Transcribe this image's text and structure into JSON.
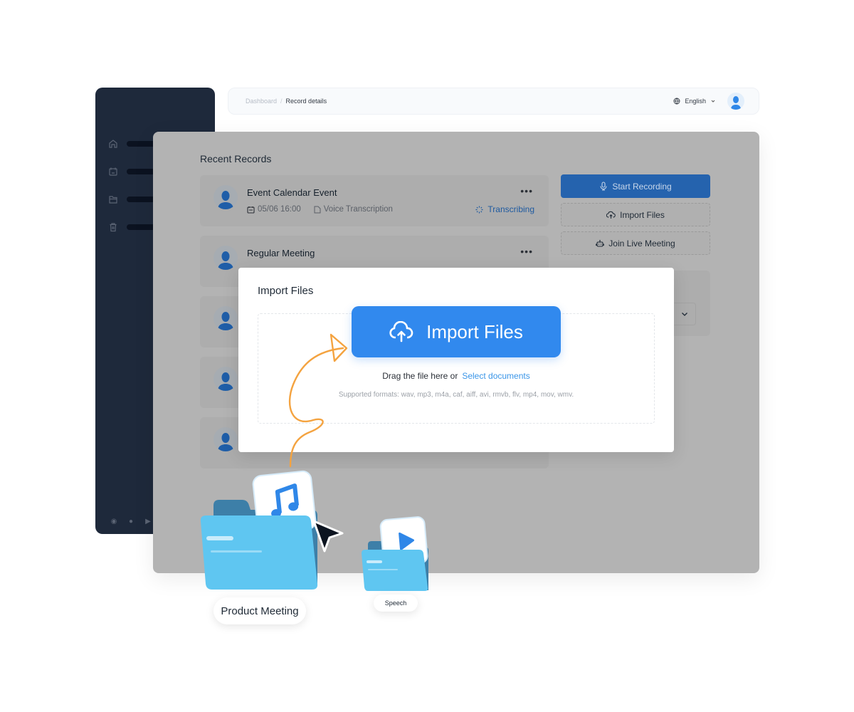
{
  "topbar": {
    "breadcrumb": [
      "Dashboard",
      "Record details"
    ],
    "breadcrumb_separator": "/",
    "language": "English"
  },
  "sidebar": {
    "items": [
      {
        "icon": "home-icon"
      },
      {
        "icon": "calendar-icon"
      },
      {
        "icon": "folder-icon"
      },
      {
        "icon": "trash-icon"
      }
    ],
    "footer_icons": [
      "chrome-icon",
      "apple-icon",
      "play-store-icon"
    ]
  },
  "main": {
    "title": "Recent Records",
    "records": [
      {
        "title": "Event Calendar Event",
        "date": "05/06 16:00",
        "type": "Voice Transcription",
        "status": "Transcribing",
        "more": "•••"
      },
      {
        "title": "Regular Meeting",
        "more": "•••"
      },
      {
        "title": ""
      },
      {
        "title": ""
      },
      {
        "title": ""
      }
    ],
    "actions": {
      "start_recording": "Start Recording",
      "import_files": "Import Files",
      "join_live_meeting": "Join Live Meeting"
    }
  },
  "modal": {
    "title": "Import Files",
    "import_button": "Import Files",
    "drag_text": "Drag the file here or",
    "select_link": "Select documents",
    "formats": "Supported formats: wav, mp3, m4a, caf, aiff, avi, rmvb, flv, mp4, mov, wmv."
  },
  "illustration": {
    "big_folder_label": "Product Meeting",
    "small_folder_label": "Speech"
  },
  "colors": {
    "primary": "#3189ee",
    "sidebar": "#1e293b",
    "link": "#3b96e8",
    "arrow": "#f4a340"
  }
}
